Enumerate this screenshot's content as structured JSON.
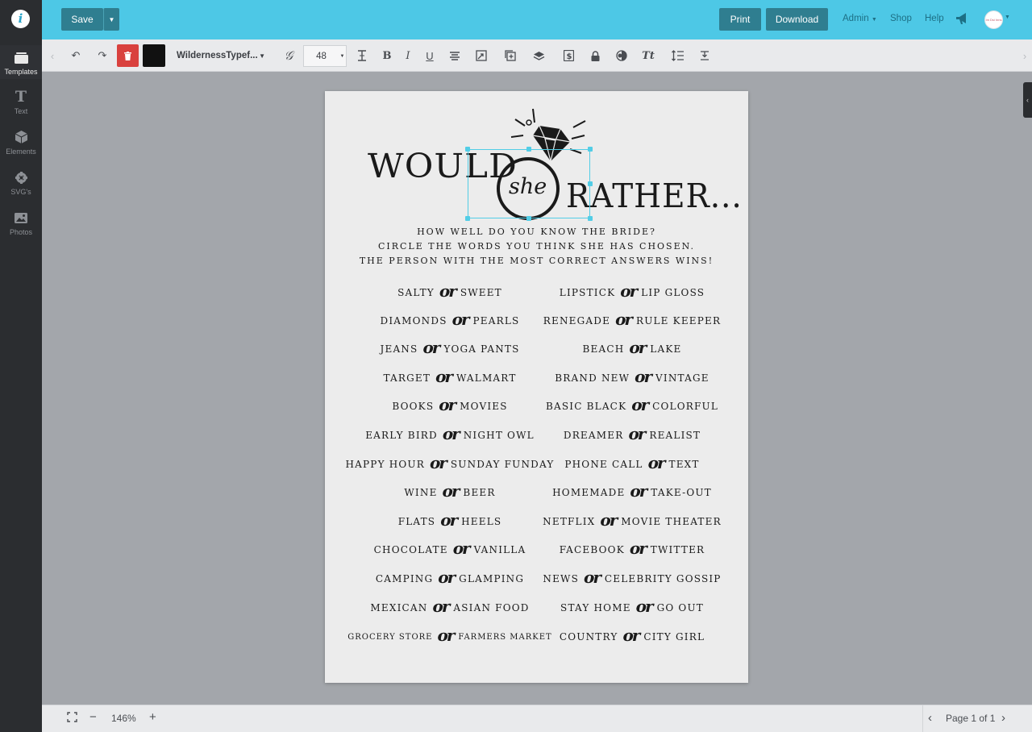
{
  "sidebar": {
    "logo_letter": "i",
    "items": [
      {
        "label": "Templates",
        "icon": "templates-icon"
      },
      {
        "label": "Text",
        "icon": "text-icon"
      },
      {
        "label": "Elements",
        "icon": "elements-icon"
      },
      {
        "label": "SVG's",
        "icon": "svg-icon"
      },
      {
        "label": "Photos",
        "icon": "photos-icon"
      }
    ]
  },
  "topbar": {
    "save_label": "Save",
    "print_label": "Print",
    "download_label": "Download",
    "admin_label": "Admin",
    "shop_label": "Shop",
    "help_label": "Help",
    "avatar_text": "Im Dsi Inns"
  },
  "toolbar": {
    "font_name": "WildernessTypef...",
    "font_size": "48",
    "text_color": "#111111",
    "bold": "B",
    "italic": "I",
    "underline": "U",
    "text_style": "Tt"
  },
  "document": {
    "title_would": "WOULD",
    "title_she": "she",
    "title_rather": "RATHER...",
    "instructions": [
      "How well do you know the bride?",
      "Circle the words you think she has chosen.",
      "The person with the most correct answers wins!"
    ],
    "or_word": "or",
    "left_pairs": [
      [
        "Salty",
        "Sweet"
      ],
      [
        "Diamonds",
        "Pearls"
      ],
      [
        "Jeans",
        "Yoga Pants"
      ],
      [
        "Target",
        "Walmart"
      ],
      [
        "Books",
        "Movies"
      ],
      [
        "Early Bird",
        "Night Owl"
      ],
      [
        "Happy Hour",
        "Sunday Funday"
      ],
      [
        "Wine",
        "Beer"
      ],
      [
        "Flats",
        "Heels"
      ],
      [
        "Chocolate",
        "Vanilla"
      ],
      [
        "Camping",
        "Glamping"
      ],
      [
        "Mexican",
        "Asian Food"
      ],
      [
        "Grocery Store",
        "Farmers Market"
      ]
    ],
    "right_pairs": [
      [
        "Lipstick",
        "Lip Gloss"
      ],
      [
        "Renegade",
        "Rule Keeper"
      ],
      [
        "Beach",
        "Lake"
      ],
      [
        "Brand New",
        "Vintage"
      ],
      [
        "Basic Black",
        "Colorful"
      ],
      [
        "Dreamer",
        "Realist"
      ],
      [
        "Phone Call",
        "Text"
      ],
      [
        "Homemade",
        "Take-Out"
      ],
      [
        "Netflix",
        "Movie Theater"
      ],
      [
        "Facebook",
        "Twitter"
      ],
      [
        "News",
        "Celebrity Gossip"
      ],
      [
        "Stay Home",
        "Go Out"
      ],
      [
        "Country",
        "City Girl"
      ]
    ]
  },
  "bottombar": {
    "zoom": "146%",
    "page_indicator": "Page 1 of 1"
  }
}
